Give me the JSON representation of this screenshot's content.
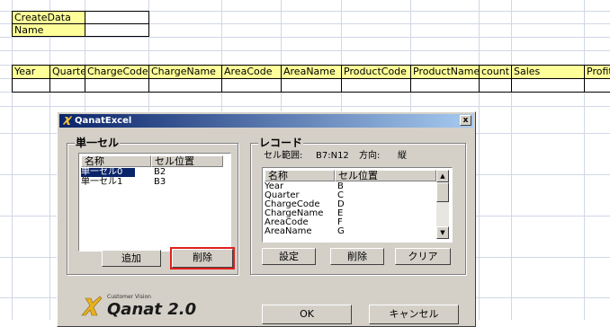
{
  "sheet": {
    "top_rows": [
      "CreateData",
      "Name"
    ],
    "headers": [
      "Year",
      "Quarter",
      "ChargeCode",
      "ChargeName",
      "AreaCode",
      "AreaName",
      "ProductCode",
      "ProductName",
      "count",
      "Sales",
      "Profits"
    ]
  },
  "dialog": {
    "title": "QanatExcel",
    "close": "x",
    "single": {
      "title": "単一セル",
      "col_name": "名称",
      "col_pos": "セル位置",
      "rows": [
        {
          "name": "単一セル0",
          "pos": "B2"
        },
        {
          "name": "単一セル1",
          "pos": "B3"
        }
      ],
      "add": "追加",
      "delete": "削除"
    },
    "record": {
      "title": "レコード",
      "range_label": "セル範囲:",
      "range_value": "B7:N12",
      "dir_label": "方向:",
      "dir_value": "縦",
      "col_name": "名称",
      "col_pos": "セル位置",
      "rows": [
        {
          "name": "Year",
          "pos": "B"
        },
        {
          "name": "Quarter",
          "pos": "C"
        },
        {
          "name": "ChargeCode",
          "pos": "D"
        },
        {
          "name": "ChargeName",
          "pos": "E"
        },
        {
          "name": "AreaCode",
          "pos": "F"
        },
        {
          "name": "AreaName",
          "pos": "G"
        }
      ],
      "set": "設定",
      "delete": "削除",
      "clear": "クリア",
      "scroll_up": "▲",
      "scroll_down": "▼"
    },
    "logo": {
      "small": "Customer Vision",
      "text": "Qanat 2.0"
    },
    "ok": "OK",
    "cancel": "キャンセル"
  },
  "colors": {
    "highlight_border": "#e0201c",
    "selection": "#0a246a",
    "yellow_cell": "#ffff99"
  }
}
